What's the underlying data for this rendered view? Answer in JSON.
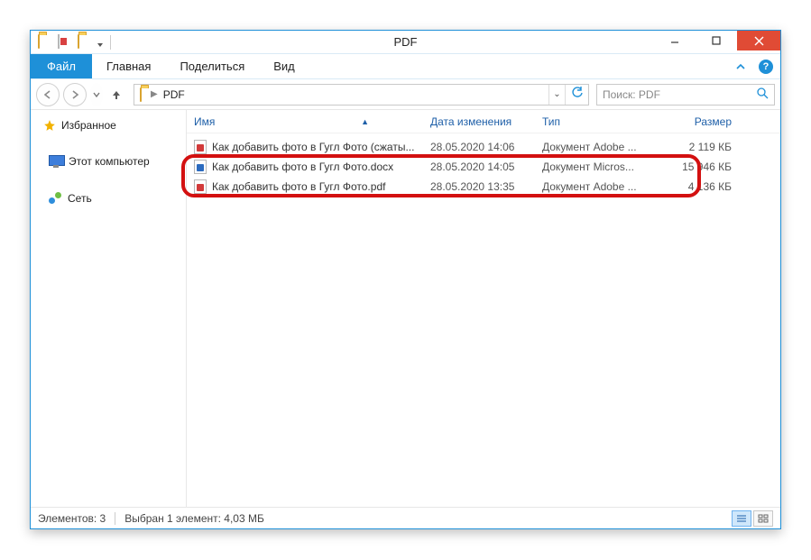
{
  "window": {
    "title": "PDF"
  },
  "ribbon": {
    "file": "Файл",
    "tabs": [
      "Главная",
      "Поделиться",
      "Вид"
    ]
  },
  "address": {
    "crumbs": [
      "PDF"
    ]
  },
  "search": {
    "placeholder": "Поиск: PDF"
  },
  "sidebar": {
    "favorites": "Избранное",
    "computer": "Этот компьютер",
    "network": "Сеть"
  },
  "columns": {
    "name": "Имя",
    "date": "Дата изменения",
    "type": "Тип",
    "size": "Размер"
  },
  "files": [
    {
      "icon": "pdf",
      "name": "Как добавить фото в Гугл Фото (сжаты...",
      "date": "28.05.2020 14:06",
      "type": "Документ Adobe ...",
      "size": "2 119 КБ"
    },
    {
      "icon": "docx",
      "name": "Как добавить фото в Гугл Фото.docx",
      "date": "28.05.2020 14:05",
      "type": "Документ Micros...",
      "size": "15 946 КБ"
    },
    {
      "icon": "pdf",
      "name": "Как добавить фото в Гугл Фото.pdf",
      "date": "28.05.2020 13:35",
      "type": "Документ Adobe ...",
      "size": "4 136 КБ"
    }
  ],
  "status": {
    "count": "Элементов: 3",
    "selection": "Выбран 1 элемент: 4,03 МБ"
  }
}
